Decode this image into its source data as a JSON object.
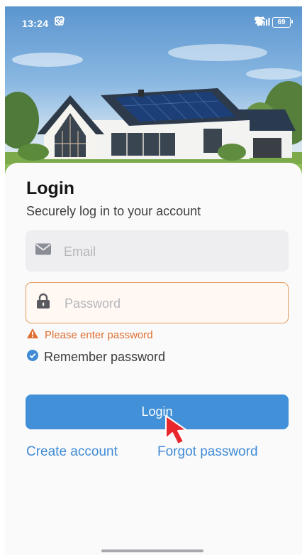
{
  "status_bar": {
    "time": "13:24",
    "left_icons": [
      "nfc-icon",
      "heart-icon",
      "heart-icon"
    ],
    "right_icons": [
      "alarm-icon",
      "bluetooth-icon",
      "wifi-icon",
      "signal-5g-icon",
      "signal-5g-icon"
    ],
    "signal_label": "5G",
    "battery": "69"
  },
  "hero": {
    "image": "house-with-solar-panels"
  },
  "login": {
    "title": "Login",
    "subtitle": "Securely log in to your account",
    "email": {
      "placeholder": "Email",
      "value": "",
      "icon": "mail-icon"
    },
    "password": {
      "placeholder": "Password",
      "value": "",
      "icon": "lock-icon"
    },
    "error_message": "Please enter password",
    "remember_label": "Remember password",
    "remember_checked": true,
    "button_label": "Login",
    "create_account": "Create account",
    "forgot_password": "Forgot password"
  },
  "colors": {
    "accent": "#4190d8",
    "error": "#df6f30",
    "link": "#3f8bd6"
  }
}
